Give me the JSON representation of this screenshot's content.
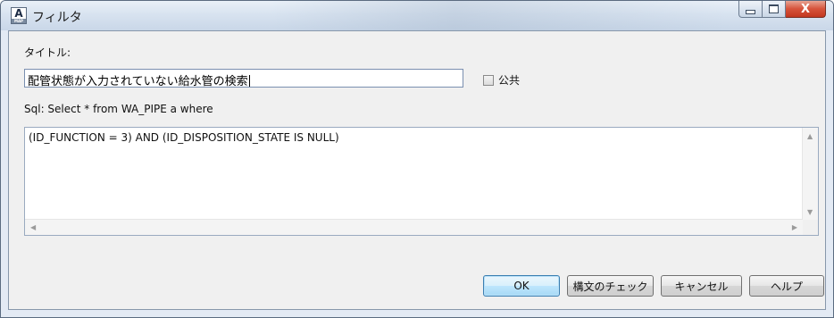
{
  "window": {
    "title": "フィルタ",
    "app_icon_letter": "A",
    "app_icon_sub": "MAP",
    "controls": {
      "minimize": "",
      "maximize": "",
      "close": "X"
    }
  },
  "form": {
    "title_label": "タイトル:",
    "title_value": "配管状態が入力されていない給水管の検索",
    "public_label": "公共",
    "public_checked": false,
    "sql_prefix": "Sql: Select * from WA_PIPE a where",
    "sql_text": "(ID_FUNCTION = 3) AND (ID_DISPOSITION_STATE IS NULL)"
  },
  "scroll_icons": {
    "up": "▲",
    "down": "▼",
    "left": "◀",
    "right": "▶"
  },
  "buttons": {
    "ok": "OK",
    "check_syntax": "構文のチェック",
    "cancel": "キャンセル",
    "help": "ヘルプ"
  }
}
